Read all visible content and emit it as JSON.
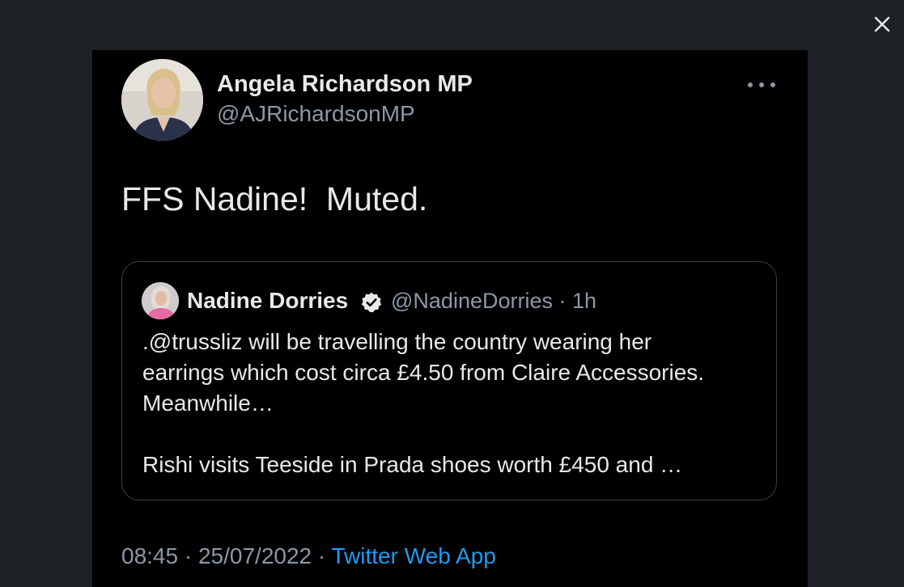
{
  "tweet": {
    "author_name": "Angela Richardson MP",
    "author_handle": "@AJRichardsonMP",
    "text": "FFS Nadine!  Muted.",
    "time": "08:45",
    "separator": "·",
    "date": "25/07/2022",
    "source": "Twitter Web App"
  },
  "quoted": {
    "author_name": "Nadine Dorries",
    "author_handle": "@NadineDorries",
    "separator": "·",
    "age": "1h",
    "line1": ".@trussliz will be travelling the country wearing her",
    "line2": "earrings which cost circa £4.50 from Claire Accessories.",
    "line3": "Meanwhile…",
    "line4": "Rishi visits Teeside in Prada shoes worth £450 and …"
  },
  "icons": {
    "close": "close-icon",
    "more": "more-options-icon",
    "verified": "verified-badge-icon"
  },
  "colors": {
    "overlay_bg": "#1e2227",
    "card_bg": "#000000",
    "link": "#1d9bf0",
    "secondary_text": "#8b98a5"
  }
}
